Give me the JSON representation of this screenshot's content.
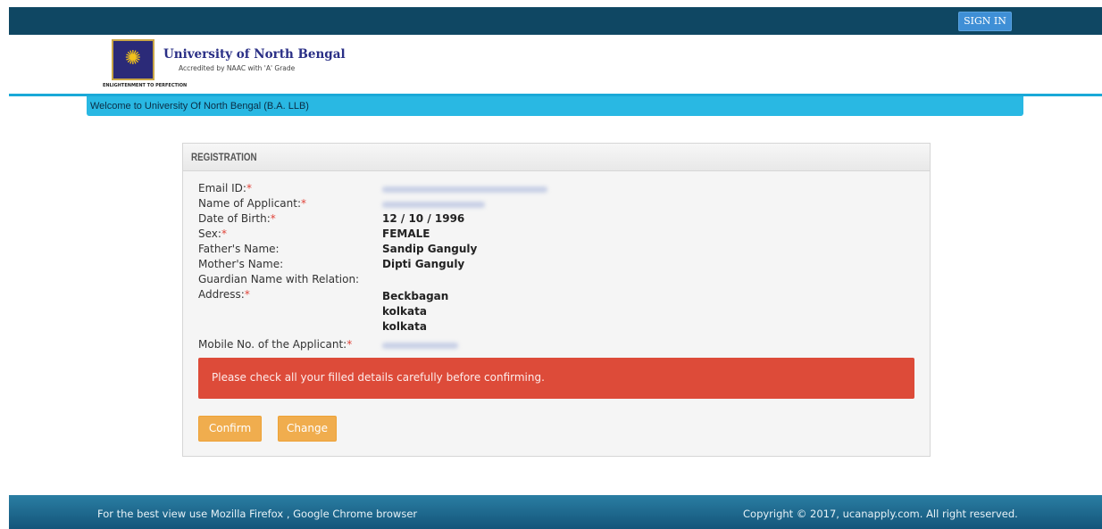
{
  "topbar": {
    "signin_label": "SIGN IN"
  },
  "header": {
    "university_name": "University of North Bengal",
    "accreditation": "Accredited by NAAC with 'A' Grade",
    "logo_motto": "ENLIGHTENMENT TO PERFECTION"
  },
  "welcome_text": "Welcome to University Of North Bengal (B.A. LLB)",
  "panel": {
    "title": "REGISTRATION",
    "fields": [
      {
        "label": "Email ID:",
        "required": "*",
        "value": ""
      },
      {
        "label": "Name of Applicant:",
        "required": "*",
        "value": ""
      },
      {
        "label": "Date of Birth:",
        "required": "*",
        "value": "12 / 10 / 1996"
      },
      {
        "label": "Sex:",
        "required": "*",
        "value": "FEMALE"
      },
      {
        "label": "Father's Name:",
        "required": "",
        "value": "Sandip Ganguly"
      },
      {
        "label": "Mother's Name:",
        "required": "",
        "value": "Dipti Ganguly"
      },
      {
        "label": "Guardian Name with Relation:",
        "required": "",
        "value": ""
      },
      {
        "label": "Address:",
        "required": "*",
        "value": "Beckbagan",
        "line2": "kolkata",
        "line3": "kolkata"
      },
      {
        "label": "Mobile No. of the Applicant:",
        "required": "*",
        "value": ""
      }
    ],
    "alert": "Please check all your filled details carefully before confirming.",
    "confirm_label": "Confirm",
    "change_label": "Change"
  },
  "footer": {
    "left": "For the best view use Mozilla Firefox , Google Chrome browser",
    "right": "Copyright © 2017, ucanapply.com. All right reserved."
  },
  "colors": {
    "topbar": "#0f4763",
    "welcome_bar": "#29b8e3",
    "alert": "#dd4b39",
    "button": "#f0ad4e",
    "footer": "#14557a"
  }
}
